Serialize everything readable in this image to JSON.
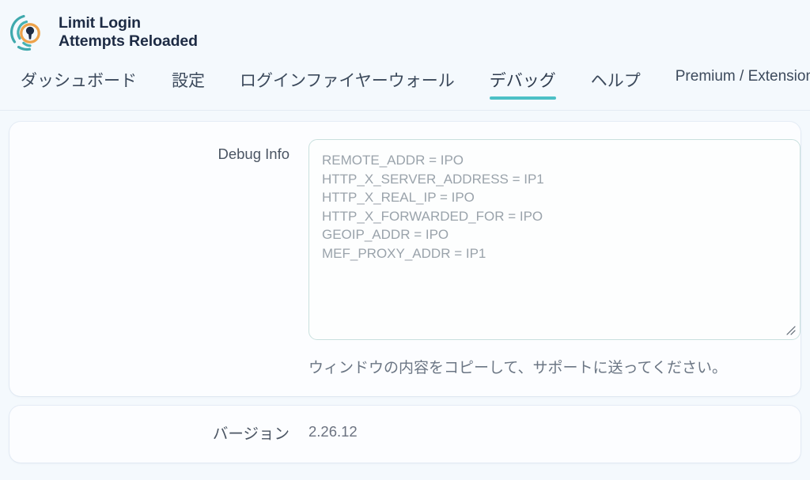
{
  "brand": {
    "logo_icon": "keyhole-signal-logo",
    "line1": "Limit Login",
    "line2": "Attempts Reloaded"
  },
  "nav": {
    "tabs": [
      {
        "label": "ダッシュボード",
        "active": false,
        "latin": false
      },
      {
        "label": "設定",
        "active": false,
        "latin": false
      },
      {
        "label": "ログインファイヤーウォール",
        "active": false,
        "latin": false
      },
      {
        "label": "デバッグ",
        "active": true,
        "latin": false
      },
      {
        "label": "ヘルプ",
        "active": false,
        "latin": false
      },
      {
        "label": "Premium / Extensions",
        "active": false,
        "latin": true
      }
    ],
    "active_index": 3
  },
  "debug_section": {
    "label": "Debug Info",
    "textarea_value": "REMOTE_ADDR = IPO\nHTTP_X_SERVER_ADDRESS = IP1\nHTTP_X_REAL_IP = IPO\nHTTP_X_FORWARDED_FOR = IPO\nGEOIP_ADDR = IPO\nMEF_PROXY_ADDR = IP1",
    "textarea_placeholder": "",
    "resize_icon": "resize-grip-icon",
    "help_text": "ウィンドウの内容をコピーして、サポートに送ってください。"
  },
  "version_section": {
    "label": "バージョン",
    "value": "2.26.12"
  },
  "colors": {
    "page_background": "#f4f9fd",
    "card_background": "#fcfdff",
    "accent_teal": "#4cc0c6",
    "logo_orange": "#eda24a",
    "logo_teal": "#3fa9ad",
    "logo_navy": "#1d2b44",
    "textarea_border": "#c9e0de",
    "text_muted": "#9aa3ab"
  }
}
